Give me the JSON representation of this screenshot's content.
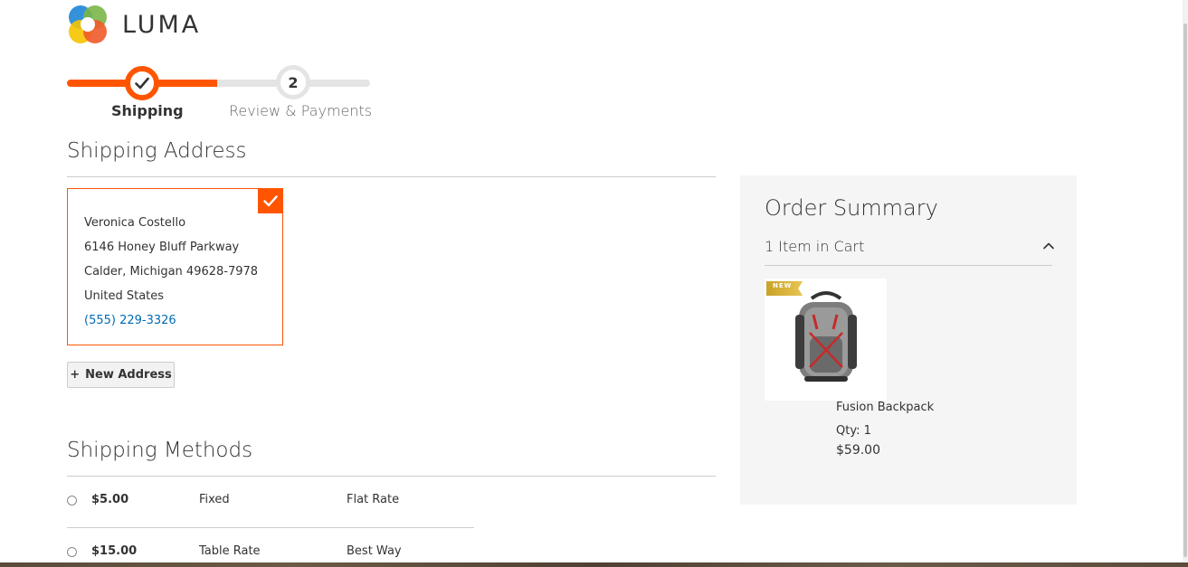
{
  "brand": {
    "name": "LUMA"
  },
  "progress": {
    "steps": [
      {
        "label": "Shipping",
        "state": "complete"
      },
      {
        "label": "Review & Payments",
        "number": "2",
        "state": "pending"
      }
    ]
  },
  "shipping_address": {
    "title": "Shipping Address",
    "selected_address": {
      "name": "Veronica Costello",
      "street": "6146 Honey Bluff Parkway",
      "city_line": "Calder, Michigan 49628-7978",
      "country": "United States",
      "phone": "(555) 229-3326"
    },
    "new_address_label": "New Address"
  },
  "shipping_methods": {
    "title": "Shipping Methods",
    "methods": [
      {
        "price": "$5.00",
        "method": "Fixed",
        "carrier": "Flat Rate"
      },
      {
        "price": "$15.00",
        "method": "Table Rate",
        "carrier": "Best Way"
      }
    ]
  },
  "order_summary": {
    "title": "Order Summary",
    "items_in_cart": "1 Item in Cart",
    "items": [
      {
        "name": "Fusion Backpack",
        "qty": "Qty: 1",
        "price": "$59.00",
        "badge": "NEW"
      }
    ]
  },
  "colors": {
    "accent": "#ff5501",
    "link": "#006bb4",
    "summary_bg": "#f5f5f5"
  }
}
